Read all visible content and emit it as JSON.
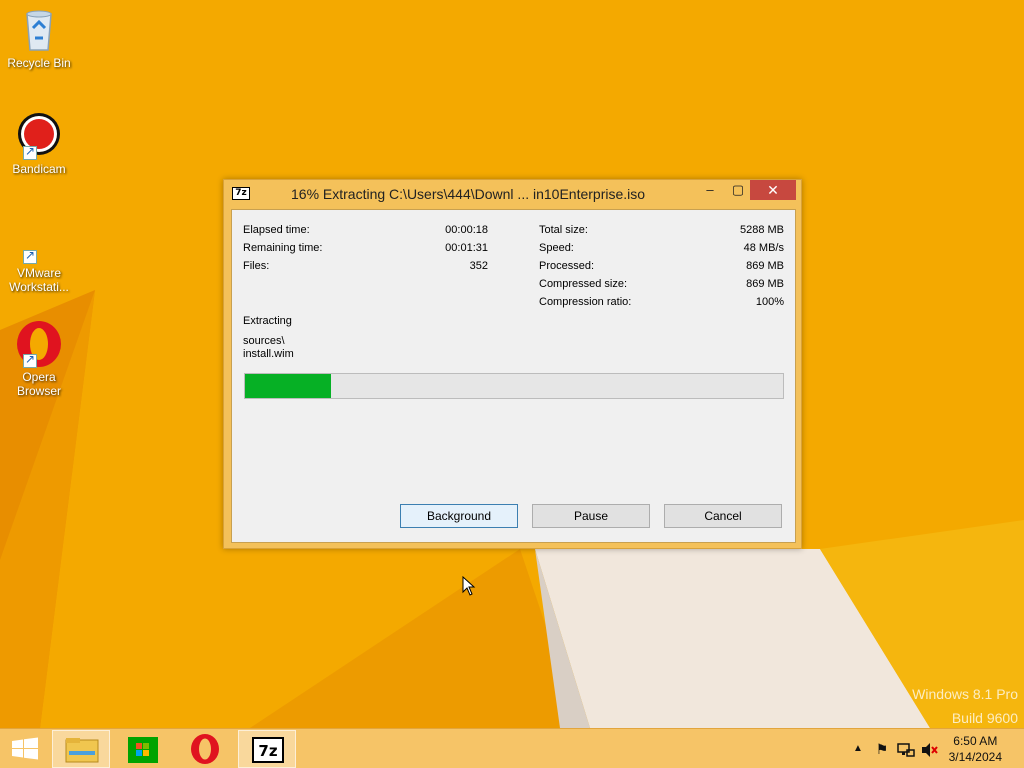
{
  "desktop": {
    "icons": [
      {
        "label": "Recycle Bin",
        "icon": "recycle-bin-icon"
      },
      {
        "label": "Bandicam",
        "icon": "bandicam-icon"
      },
      {
        "label": "VMware Workstati...",
        "icon": "vmware-icon"
      },
      {
        "label": "Opera Browser",
        "icon": "opera-icon"
      }
    ],
    "watermark": {
      "line1": "Windows 8.1 Pro",
      "line2": "Build 9600"
    }
  },
  "dialog": {
    "app_icon_text": "7z",
    "title": "16% Extracting C:\\Users\\444\\Downl ... in10Enterprise.iso",
    "left_stats": [
      {
        "label": "Elapsed time:",
        "value": "00:00:18"
      },
      {
        "label": "Remaining time:",
        "value": "00:01:31"
      },
      {
        "label": "Files:",
        "value": "352"
      }
    ],
    "right_stats": [
      {
        "label": "Total size:",
        "value": "5288 MB"
      },
      {
        "label": "Speed:",
        "value": "48 MB/s"
      },
      {
        "label": "Processed:",
        "value": "869 MB"
      },
      {
        "label": "Compressed size:",
        "value": "869 MB"
      },
      {
        "label": "Compression ratio:",
        "value": "100%"
      }
    ],
    "status_label": "Extracting",
    "current_path": "sources\\",
    "current_file": "install.wim",
    "progress_fraction": 0.16,
    "progress_color": "#06b025",
    "buttons": {
      "background": "Background",
      "pause": "Pause",
      "cancel": "Cancel"
    }
  },
  "taskbar": {
    "items": [
      "start-icon",
      "file-explorer-icon",
      "store-icon",
      "opera-icon",
      "7zip-icon"
    ],
    "tray": [
      "show-hidden-icons-icon",
      "action-center-flag-icon",
      "network-icon",
      "volume-muted-icon"
    ],
    "time": "6:50 AM",
    "date": "3/14/2024"
  },
  "colors": {
    "desktop_accent": "#f5a800",
    "close_button": "#c7483f",
    "taskbar": "#f6c467"
  }
}
